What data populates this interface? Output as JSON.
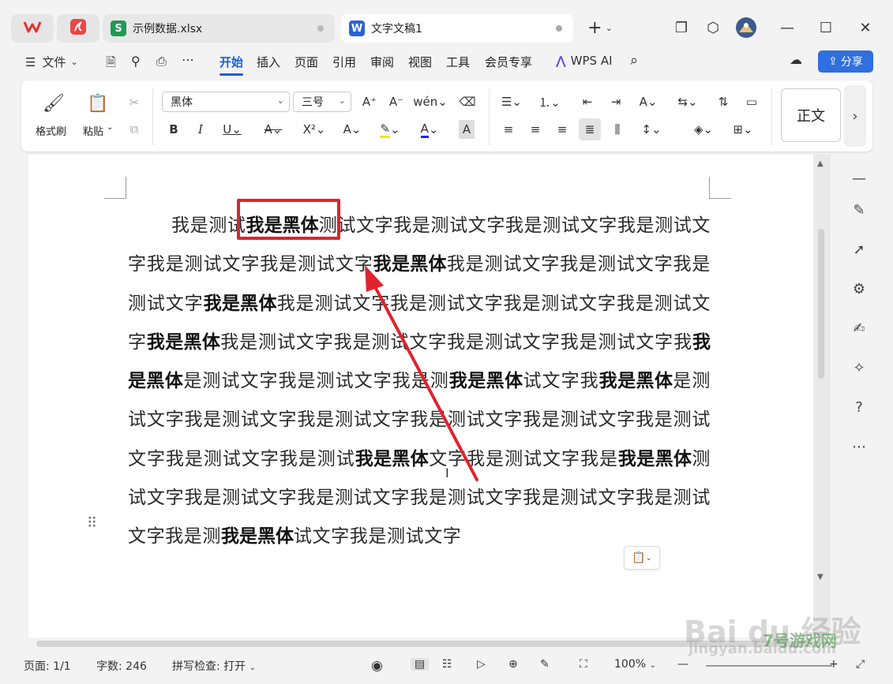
{
  "tabs": [
    {
      "label": "",
      "icon": "wps-logo-icon"
    },
    {
      "label": "",
      "icon": "pdf-app-icon"
    },
    {
      "label": "示例数据.xlsx",
      "icon": "spreadsheet-icon",
      "badge": "S"
    },
    {
      "label": "文字文稿1",
      "icon": "writer-icon",
      "badge": "W"
    }
  ],
  "menu": {
    "file": "文件",
    "items": [
      "开始",
      "插入",
      "页面",
      "引用",
      "审阅",
      "视图",
      "工具",
      "会员专享"
    ],
    "active": "开始",
    "wps_ai": "WPS AI",
    "share": "分享"
  },
  "ribbon": {
    "format_painter": "格式刷",
    "paste": "粘贴",
    "font_name": "黑体",
    "font_size": "三号",
    "style_name": "正文"
  },
  "document": {
    "paragraph_segments": [
      {
        "t": "我是测试",
        "bold": false
      },
      {
        "t": "我是黑体",
        "bold": true
      },
      {
        "t": "测试文字我是测试文字我是测试文字我是测试文字我是测试文字我是测试文字",
        "bold": false
      },
      {
        "t": "我是黑体",
        "bold": true
      },
      {
        "t": "我是测试文字我是测试文字我是测试文字",
        "bold": false
      },
      {
        "t": "我是黑体",
        "bold": true
      },
      {
        "t": "我是测试文字我是测试文字我是测试文字我是测试文字",
        "bold": false
      },
      {
        "t": "我是黑体",
        "bold": true
      },
      {
        "t": "我是测试文字我是测试文字我是测试文字我是测试文字我",
        "bold": false
      },
      {
        "t": "我是黑体",
        "bold": true
      },
      {
        "t": "是测试文字我是测试文字我是测",
        "bold": false
      },
      {
        "t": "我是黑体",
        "bold": true
      },
      {
        "t": "试文字我",
        "bold": false
      },
      {
        "t": "我是黑体",
        "bold": true
      },
      {
        "t": "是测试文字我是测试文字我是测试文字我是测试文字我是测试文字我是测试文字我是测试文字我是测试",
        "bold": false
      },
      {
        "t": "我是黑体",
        "bold": true
      },
      {
        "t": "文字我是测试文字我是",
        "bold": false
      },
      {
        "t": "我是黑体",
        "bold": true
      },
      {
        "t": "测试文字我是测试文字我是测试文字我是测试文字我是测试文字我是测试文字我是测",
        "bold": false
      },
      {
        "t": "我是黑体",
        "bold": true
      },
      {
        "t": "试文字我是测试文字",
        "bold": false
      }
    ]
  },
  "status": {
    "page": "页面: 1/1",
    "word_count": "字数: 246",
    "spell_check": "拼写检查: 打开",
    "zoom": "100%"
  },
  "colors": {
    "accent": "#1a5fd6",
    "share_bg": "#2f6fdf",
    "highlight_box": "#e0232e",
    "arrow": "#e0232e"
  },
  "watermark": {
    "text": "Bai du 经验",
    "sub": "jingyan.baidu.com",
    "site": "7号游戏网"
  }
}
